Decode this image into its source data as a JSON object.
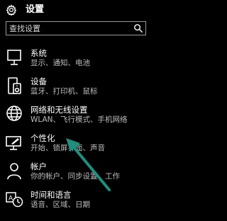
{
  "header": {
    "title": "设置",
    "icon": "gear-icon"
  },
  "search": {
    "placeholder": "查找设置",
    "icon": "search-icon"
  },
  "items": [
    {
      "label": "系统",
      "description": "显示、通知、电池",
      "icon": "monitor-icon"
    },
    {
      "label": "设备",
      "description": "蓝牙、打印机、鼠标",
      "icon": "devices-icon"
    },
    {
      "label": "网络和无线设置",
      "description": "WLAN、飞行模式、手机网络",
      "icon": "globe-icon"
    },
    {
      "label": "个性化",
      "description": "开始、锁屏界面、声音",
      "icon": "personalization-icon"
    },
    {
      "label": "帐户",
      "description": "你的帐户、同步设置、工作",
      "icon": "person-icon"
    },
    {
      "label": "时间和语言",
      "description": "语音、区域、日期",
      "icon": "time-language-icon"
    }
  ],
  "colors": {
    "background": "#000000",
    "accent_arrow": "#1f8f7f",
    "secondary_text": "#bdbdbd"
  }
}
